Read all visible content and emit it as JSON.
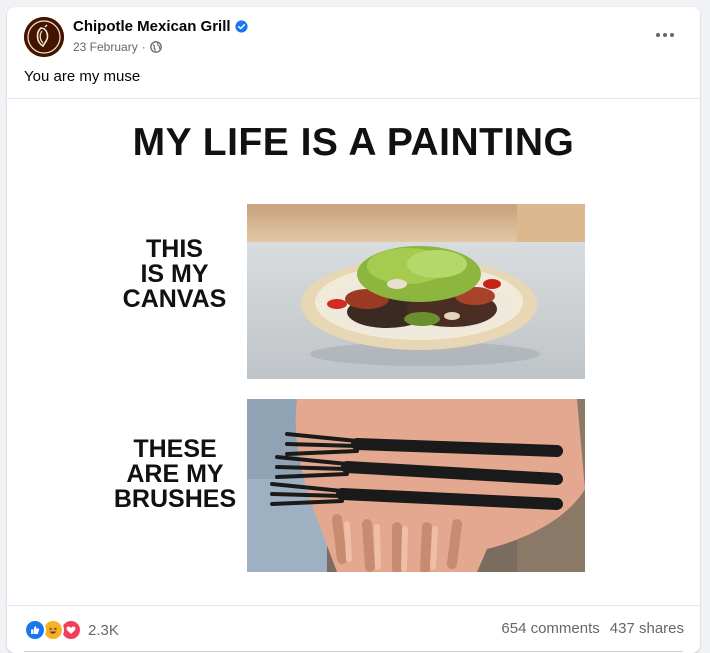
{
  "post": {
    "page_name": "Chipotle Mexican Grill",
    "date": "23 February",
    "separator": "·",
    "text": "You are my muse"
  },
  "meme": {
    "title": "MY LIFE IS A PAINTING",
    "caption1": "THIS\nIS MY\nCANVAS",
    "caption2": "THESE\nARE MY\nBRUSHES"
  },
  "stats": {
    "reaction_count": "2.3K",
    "comments": "654 comments",
    "shares": "437 shares",
    "reactions": [
      "like-icon",
      "haha-icon",
      "love-icon"
    ]
  },
  "colors": {
    "brand": "#451400",
    "like": "#1877f2",
    "love": "#f33e58",
    "haha": "#f7b125",
    "secondary_text": "#65676b"
  }
}
